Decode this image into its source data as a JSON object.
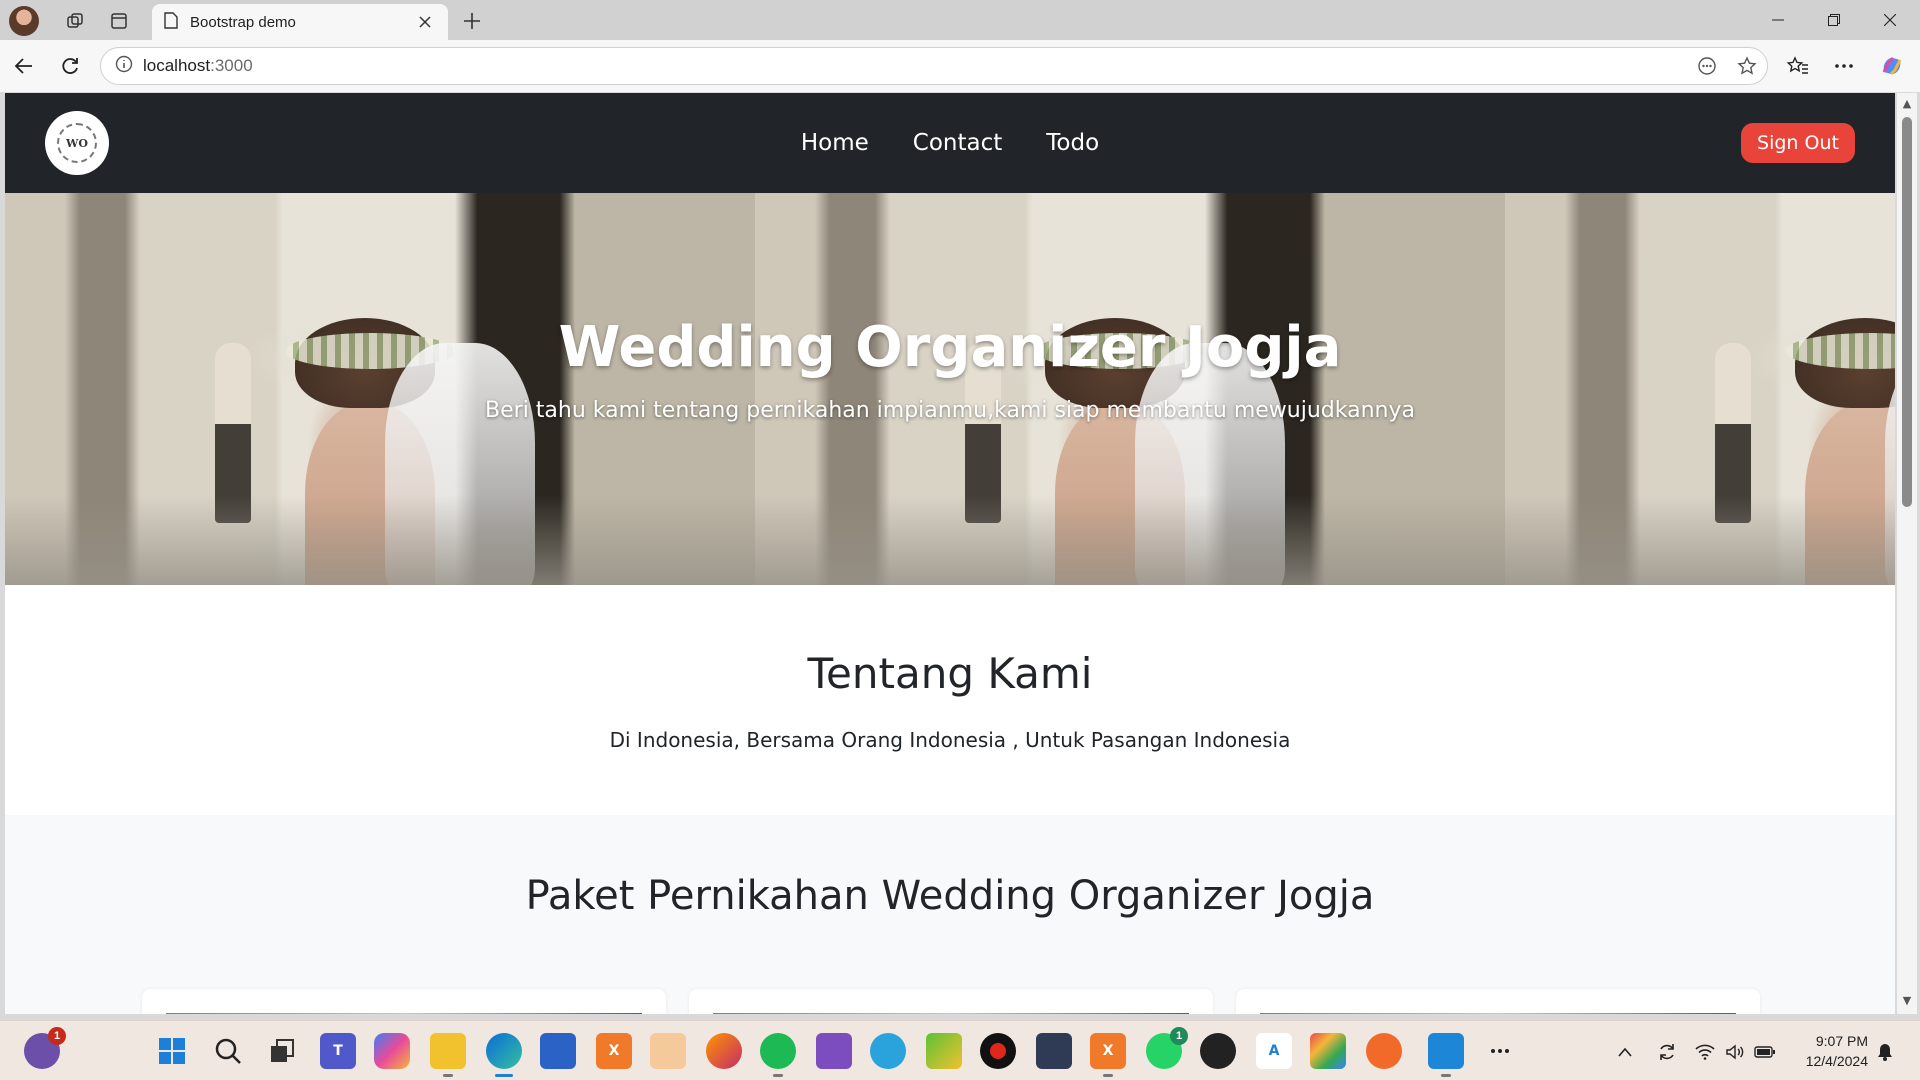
{
  "browser": {
    "tab_title": "Bootstrap demo",
    "url_host": "localhost",
    "url_port": ":3000",
    "icons": {
      "workspaces": "workspaces-icon",
      "tab_actions": "tab-actions-icon",
      "page": "page-icon",
      "close_tab": "close-icon",
      "new_tab": "plus-icon",
      "back": "back-arrow-icon",
      "refresh": "refresh-icon",
      "info": "info-icon",
      "read_aloud": "read-aloud-icon",
      "favorite": "star-icon",
      "favorites": "favorites-icon",
      "more": "more-icon",
      "copilot": "copilot-icon"
    }
  },
  "site": {
    "logo_text": "WO",
    "nav": [
      "Home",
      "Contact",
      "Todo"
    ],
    "signout": "Sign Out",
    "accent": "#e8443a",
    "nav_bg": "#212529"
  },
  "hero": {
    "title": "Wedding Organizer Jogja",
    "subtitle": "Beri tahu kami tentang pernikahan impianmu,kami siap membantu mewujudkannya"
  },
  "about": {
    "title": "Tentang Kami",
    "text": "Di Indonesia, Bersama Orang Indonesia , Untuk Pasangan Indonesia"
  },
  "packages": {
    "title": "Paket Pernikahan Wedding Organizer Jogja"
  },
  "taskbar": {
    "clock_time": "9:07 PM",
    "clock_date": "12/4/2024",
    "badge_app1": "1",
    "badge_whatsapp": "1"
  }
}
